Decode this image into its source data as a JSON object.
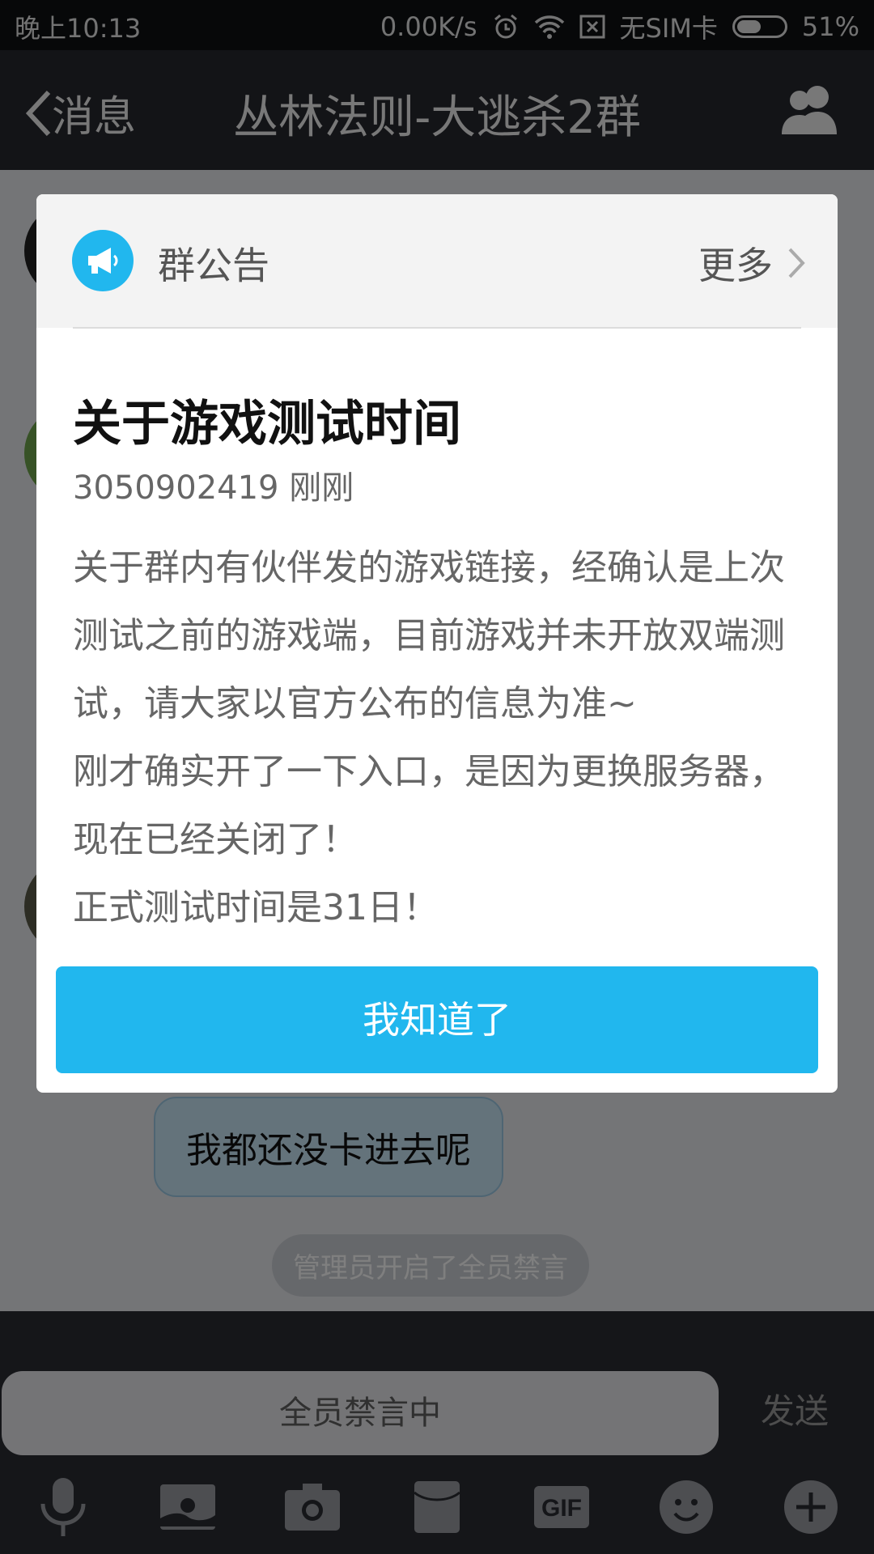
{
  "status_bar": {
    "time": "晚上10:13",
    "speed": "0.00K/s",
    "sim": "无SIM卡",
    "battery": "51%",
    "battery_level": 0.51
  },
  "title_bar": {
    "back_label": "消息",
    "title": "丛林法则-大逃杀2群",
    "members_icon": "group-members-icon"
  },
  "chat": {
    "message_text": "我都还没卡进去呢",
    "system_message": "管理员开启了全员禁言"
  },
  "input": {
    "placeholder": "全员禁言中",
    "send_label": "发送"
  },
  "toolbar": {
    "icons": [
      "microphone-icon",
      "picture-icon",
      "camera-icon",
      "red-packet-icon",
      "gif-icon",
      "emoji-icon",
      "plus-icon"
    ],
    "gif_label": "GIF"
  },
  "notice": {
    "header_label": "群公告",
    "more_label": "更多",
    "title": "关于游戏测试时间",
    "meta": "3050902419 刚刚",
    "body": [
      "关于群内有伙伴发的游戏链接，经确认是上次测试之前的游戏端，目前游戏并未开放双端测试，请大家以官方公布的信息为准~",
      "刚才确实开了一下入口，是因为更换服务器，现在已经关闭了！",
      "正式测试时间是31日！"
    ],
    "ack_label": "我知道了"
  },
  "colors": {
    "accent": "#21b7ee",
    "bubble": "#c9e6f7"
  }
}
